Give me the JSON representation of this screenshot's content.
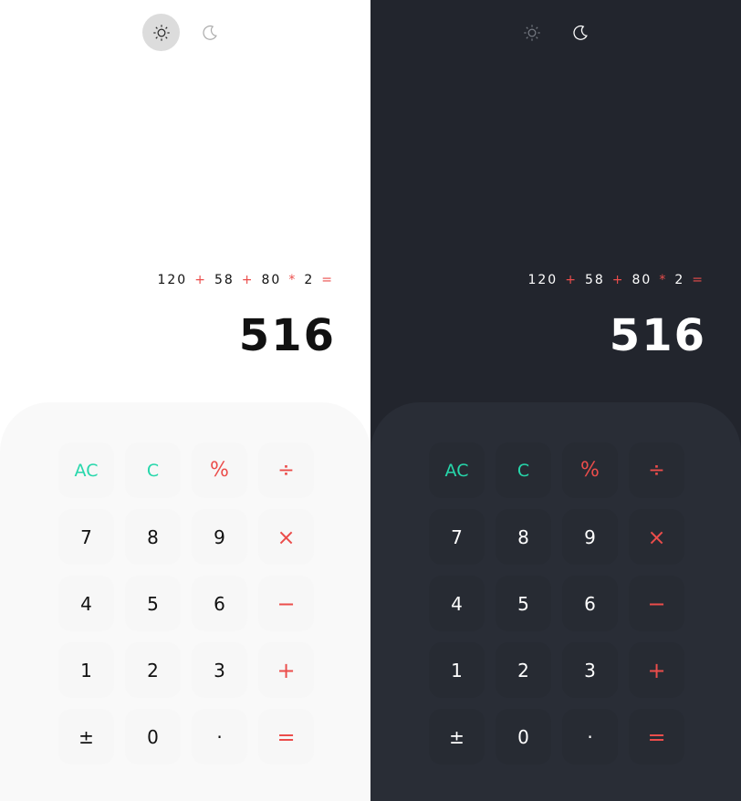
{
  "panels": {
    "light": {
      "theme": "light",
      "expression": {
        "n1": "120",
        "op1": "+",
        "n2": "58",
        "op2": "+",
        "n3": "80",
        "op3": "*",
        "n4": "2",
        "op4": "="
      },
      "result": "516"
    },
    "dark": {
      "theme": "dark",
      "expression": {
        "n1": "120",
        "op1": "+",
        "n2": "58",
        "op2": "+",
        "n3": "80",
        "op3": "*",
        "n4": "2",
        "op4": "="
      },
      "result": "516"
    }
  },
  "toggles": {
    "light_icon": "sun-icon",
    "dark_icon": "moon-icon"
  },
  "keys": {
    "ac": "AC",
    "c": "C",
    "percent": "%",
    "divide": "÷",
    "seven": "7",
    "eight": "8",
    "nine": "9",
    "multiply": "×",
    "four": "4",
    "five": "5",
    "six": "6",
    "minus": "−",
    "one": "1",
    "two": "2",
    "three": "3",
    "plus": "+",
    "plus_minus": "±",
    "zero": "0",
    "dot": "·",
    "equals": "="
  },
  "colors": {
    "accent_function": "#26d7ab",
    "accent_operator": "#eb4d4b",
    "light_bg": "#ffffff",
    "light_keypad": "#f9f9f9",
    "dark_bg": "#22252d",
    "dark_keypad": "#292d36"
  }
}
